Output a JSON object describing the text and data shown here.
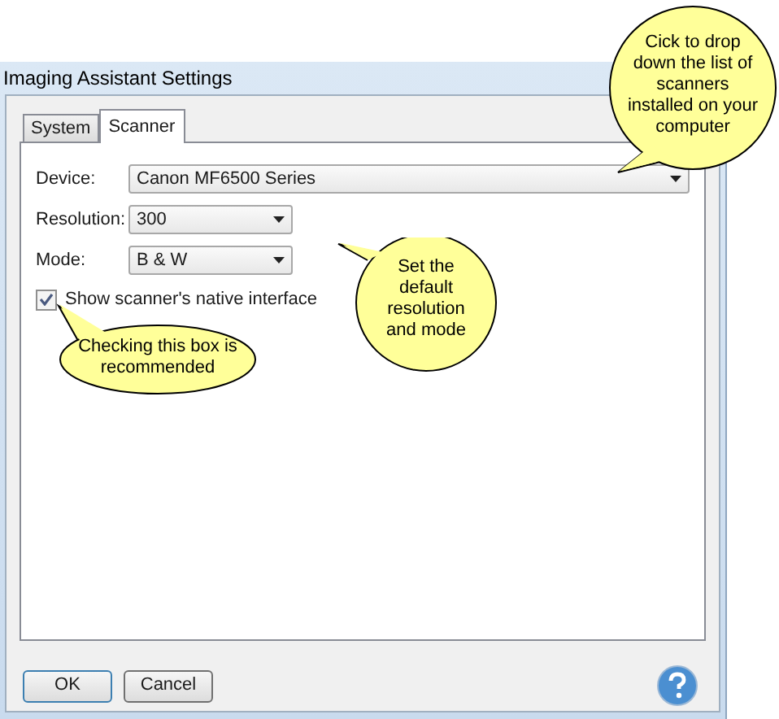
{
  "window": {
    "title": "Imaging Assistant Settings"
  },
  "tabs": [
    {
      "label": "System",
      "selected": false
    },
    {
      "label": "Scanner",
      "selected": true
    }
  ],
  "fields": [
    {
      "label": "Device:",
      "value": "Canon MF6500 Series",
      "wide": true
    },
    {
      "label": "Resolution:",
      "value": "300",
      "wide": false
    },
    {
      "label": "Mode:",
      "value": "B & W",
      "wide": false
    }
  ],
  "checkbox": {
    "label": "Show scanner's native interface",
    "checked": true
  },
  "buttons": [
    {
      "label": "OK",
      "default": true
    },
    {
      "label": "Cancel",
      "default": false
    }
  ],
  "callouts": [
    {
      "text": "Cick to drop down the list of scanners installed on your computer",
      "kind": "device"
    },
    {
      "text": "Set the default resolution and mode",
      "kind": "settings"
    },
    {
      "text": "Checking this box is recommended",
      "kind": "checkbox"
    }
  ]
}
